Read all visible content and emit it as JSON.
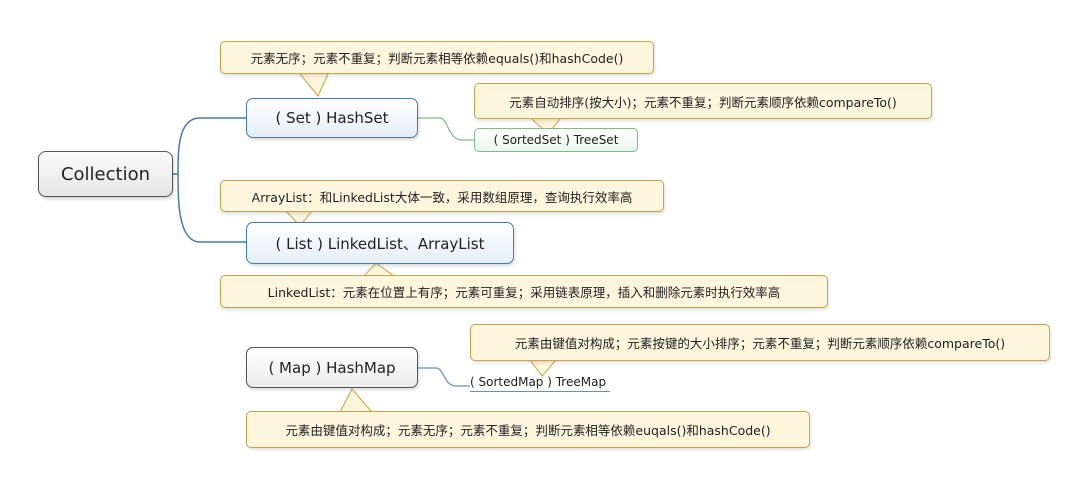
{
  "diagram": {
    "root": {
      "label": "Collection"
    },
    "set": {
      "label": "( Set ) HashSet",
      "note": "元素无序；元素不重复；判断元素相等依赖equals()和hashCode()",
      "sorted_label": "( SortedSet ) TreeSet",
      "sorted_note": "元素自动排序(按大小)；元素不重复；判断元素顺序依赖compareTo()"
    },
    "list": {
      "label": "( List ) LinkedList、ArrayList",
      "note_top": "ArrayList：和LinkedList大体一致，采用数组原理，查询执行效率高",
      "note_bottom": "LinkedList：元素在位置上有序；元素可重复；采用链表原理，插入和删除元素时执行效率高"
    },
    "map": {
      "label": "( Map ) HashMap",
      "sorted_label": "( SortedMap ) TreeMap",
      "sorted_note": "元素由键值对构成；元素按键的大小排序；元素不重复；判断元素顺序依赖compareTo()",
      "note": "元素由键值对构成；元素无序；元素不重复；判断元素相等依赖euqals()和hashCode()"
    }
  }
}
